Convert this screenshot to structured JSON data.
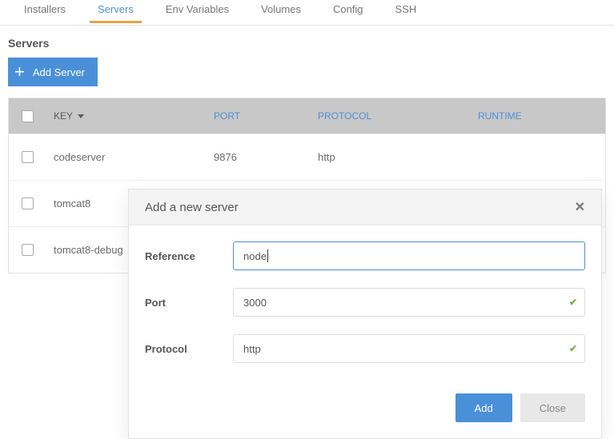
{
  "tabs": [
    "Installers",
    "Servers",
    "Env Variables",
    "Volumes",
    "Config",
    "SSH"
  ],
  "active_tab_index": 1,
  "section_title": "Servers",
  "add_button_label": "Add Server",
  "table": {
    "columns": {
      "key": "KEY",
      "port": "PORT",
      "protocol": "PROTOCOL",
      "runtime": "RUNTIME"
    },
    "rows": [
      {
        "key": "codeserver",
        "port": "9876",
        "protocol": "http",
        "runtime": ""
      },
      {
        "key": "tomcat8",
        "port": "",
        "protocol": "",
        "runtime": ""
      },
      {
        "key": "tomcat8-debug",
        "port": "",
        "protocol": "",
        "runtime": ""
      }
    ]
  },
  "modal": {
    "title": "Add a new server",
    "fields": {
      "reference": {
        "label": "Reference",
        "value": "node",
        "valid": false,
        "focused": true
      },
      "port": {
        "label": "Port",
        "value": "3000",
        "valid": true,
        "focused": false
      },
      "protocol": {
        "label": "Protocol",
        "value": "http",
        "valid": true,
        "focused": false
      }
    },
    "buttons": {
      "add": "Add",
      "close": "Close"
    }
  }
}
